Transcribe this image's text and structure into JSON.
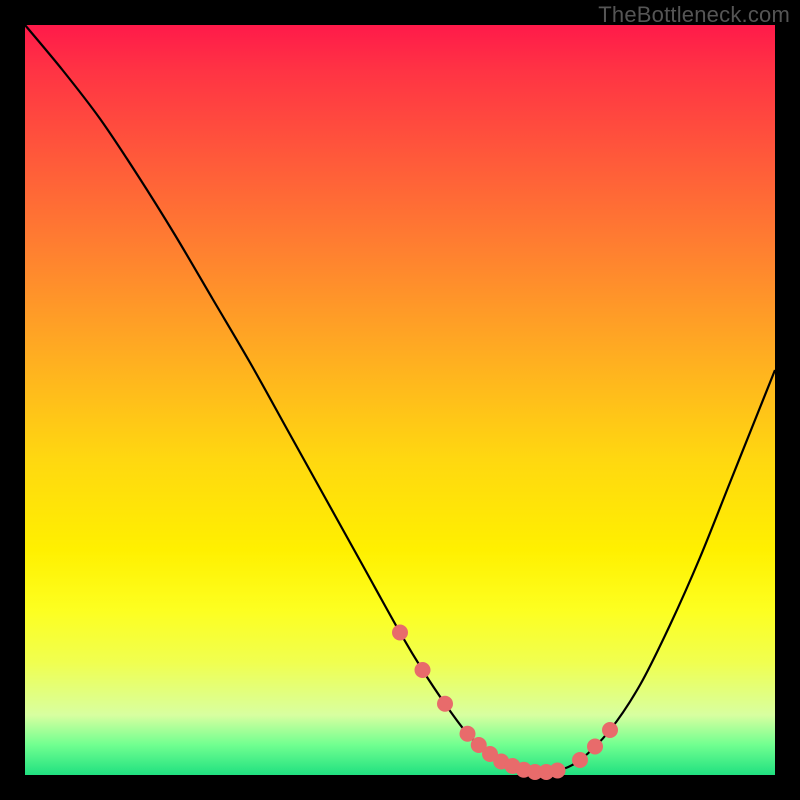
{
  "watermark": "TheBottleneck.com",
  "chart_data": {
    "type": "line",
    "title": "",
    "xlabel": "",
    "ylabel": "",
    "xlim": [
      0,
      100
    ],
    "ylim": [
      0,
      100
    ],
    "grid": false,
    "legend": false,
    "series": [
      {
        "name": "bottleneck-curve",
        "x": [
          0,
          5,
          10,
          15,
          20,
          25,
          30,
          35,
          40,
          45,
          50,
          53,
          56,
          59,
          62,
          65,
          68,
          71,
          74,
          78,
          82,
          86,
          90,
          94,
          98,
          100
        ],
        "y": [
          100,
          94,
          87.5,
          80,
          72,
          63.5,
          55,
          46,
          37,
          28,
          19,
          14,
          9.5,
          5.5,
          2.8,
          1.2,
          0.4,
          0.6,
          2,
          6,
          12,
          20,
          29,
          39,
          49,
          54
        ],
        "color": "#000000"
      }
    ],
    "markers": {
      "name": "highlight-points",
      "color": "#e86b6b",
      "radius_px": 8,
      "x": [
        50,
        53,
        56,
        59,
        60.5,
        62,
        63.5,
        65,
        66.5,
        68,
        69.5,
        71,
        74,
        76,
        78
      ],
      "y": [
        19,
        14,
        9.5,
        5.5,
        4,
        2.8,
        1.8,
        1.2,
        0.7,
        0.4,
        0.4,
        0.6,
        2,
        3.8,
        6
      ]
    }
  }
}
